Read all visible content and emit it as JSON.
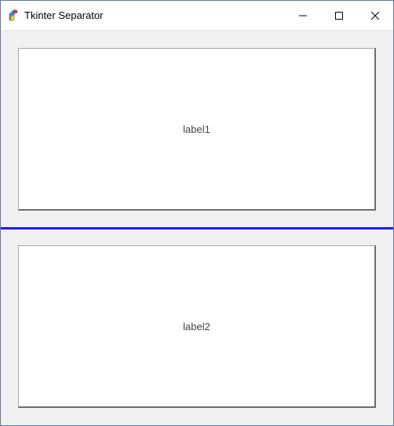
{
  "window": {
    "title": "Tkinter Separator"
  },
  "labels": {
    "label1": "label1",
    "label2": "label2"
  },
  "separator": {
    "color": "#1a1aff"
  }
}
